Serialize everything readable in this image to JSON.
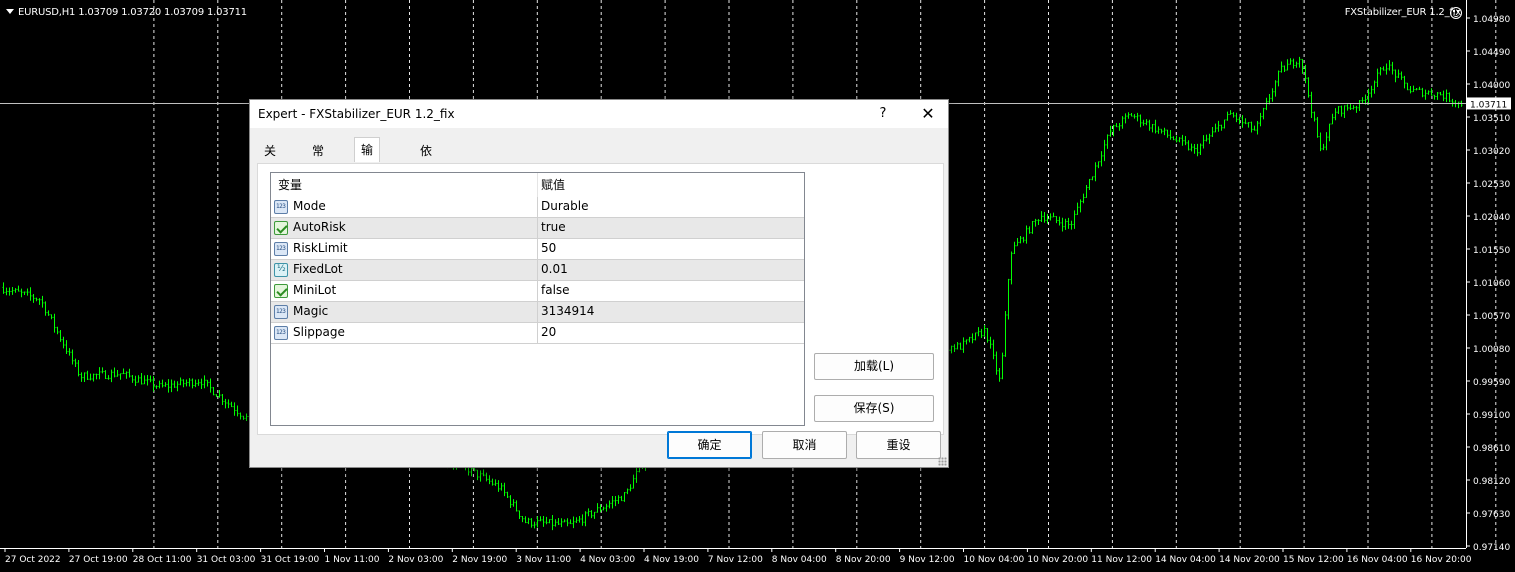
{
  "chart": {
    "symbol_info": "EURUSD,H1  1.03709 1.03720 1.03709 1.03711",
    "ea_label": "FXStabilizer_EUR 1.2_fix",
    "current_price": "1.03711",
    "colors": {
      "background": "#000000",
      "candles": "#00ff00",
      "grid": "#ffffff",
      "text": "#ffffff",
      "price_line": "#c0c0c0"
    },
    "price_axis": [
      "1.04980",
      "1.04490",
      "1.04000",
      "1.03510",
      "1.03020",
      "1.02530",
      "1.02040",
      "1.01550",
      "1.01060",
      "1.00570",
      "1.00080",
      "0.99590",
      "0.99100",
      "0.98610",
      "0.98120",
      "0.97630",
      "0.97140"
    ],
    "time_axis": [
      "27 Oct 2022",
      "27 Oct 19:00",
      "28 Oct 11:00",
      "31 Oct 03:00",
      "31 Oct 19:00",
      "1 Nov 11:00",
      "2 Nov 03:00",
      "2 Nov 19:00",
      "3 Nov 11:00",
      "4 Nov 03:00",
      "4 Nov 19:00",
      "7 Nov 12:00",
      "8 Nov 04:00",
      "8 Nov 20:00",
      "9 Nov 12:00",
      "10 Nov 04:00",
      "10 Nov 20:00",
      "11 Nov 12:00",
      "14 Nov 04:00",
      "14 Nov 20:00",
      "15 Nov 12:00",
      "16 Nov 04:00",
      "16 Nov 20:00"
    ]
  },
  "dialog": {
    "title": "Expert - FXStabilizer_EUR 1.2_fix",
    "help_glyph": "?",
    "close_glyph": "✕",
    "tabs": [
      {
        "label": "关于",
        "active": false
      },
      {
        "label": "常用",
        "active": false
      },
      {
        "label": "输入参数",
        "active": true
      },
      {
        "label": "依存关系",
        "active": false
      }
    ],
    "table": {
      "col_variable": "变量",
      "col_value": "赋值",
      "rows": [
        {
          "name": "Mode",
          "value": "Durable",
          "icon": "int-param-icon"
        },
        {
          "name": "AutoRisk",
          "value": "true",
          "icon": "bool-param-icon"
        },
        {
          "name": "RiskLimit",
          "value": "50",
          "icon": "int-param-icon"
        },
        {
          "name": "FixedLot",
          "value": "0.01",
          "icon": "double-param-icon"
        },
        {
          "name": "MiniLot",
          "value": "false",
          "icon": "bool-param-icon"
        },
        {
          "name": "Magic",
          "value": "3134914",
          "icon": "int-param-icon"
        },
        {
          "name": "Slippage",
          "value": "20",
          "icon": "int-param-icon"
        }
      ]
    },
    "load_button": "加载(L)",
    "save_button": "保存(S)",
    "ok_button": "确定",
    "cancel_button": "取消",
    "reset_button": "重设"
  }
}
